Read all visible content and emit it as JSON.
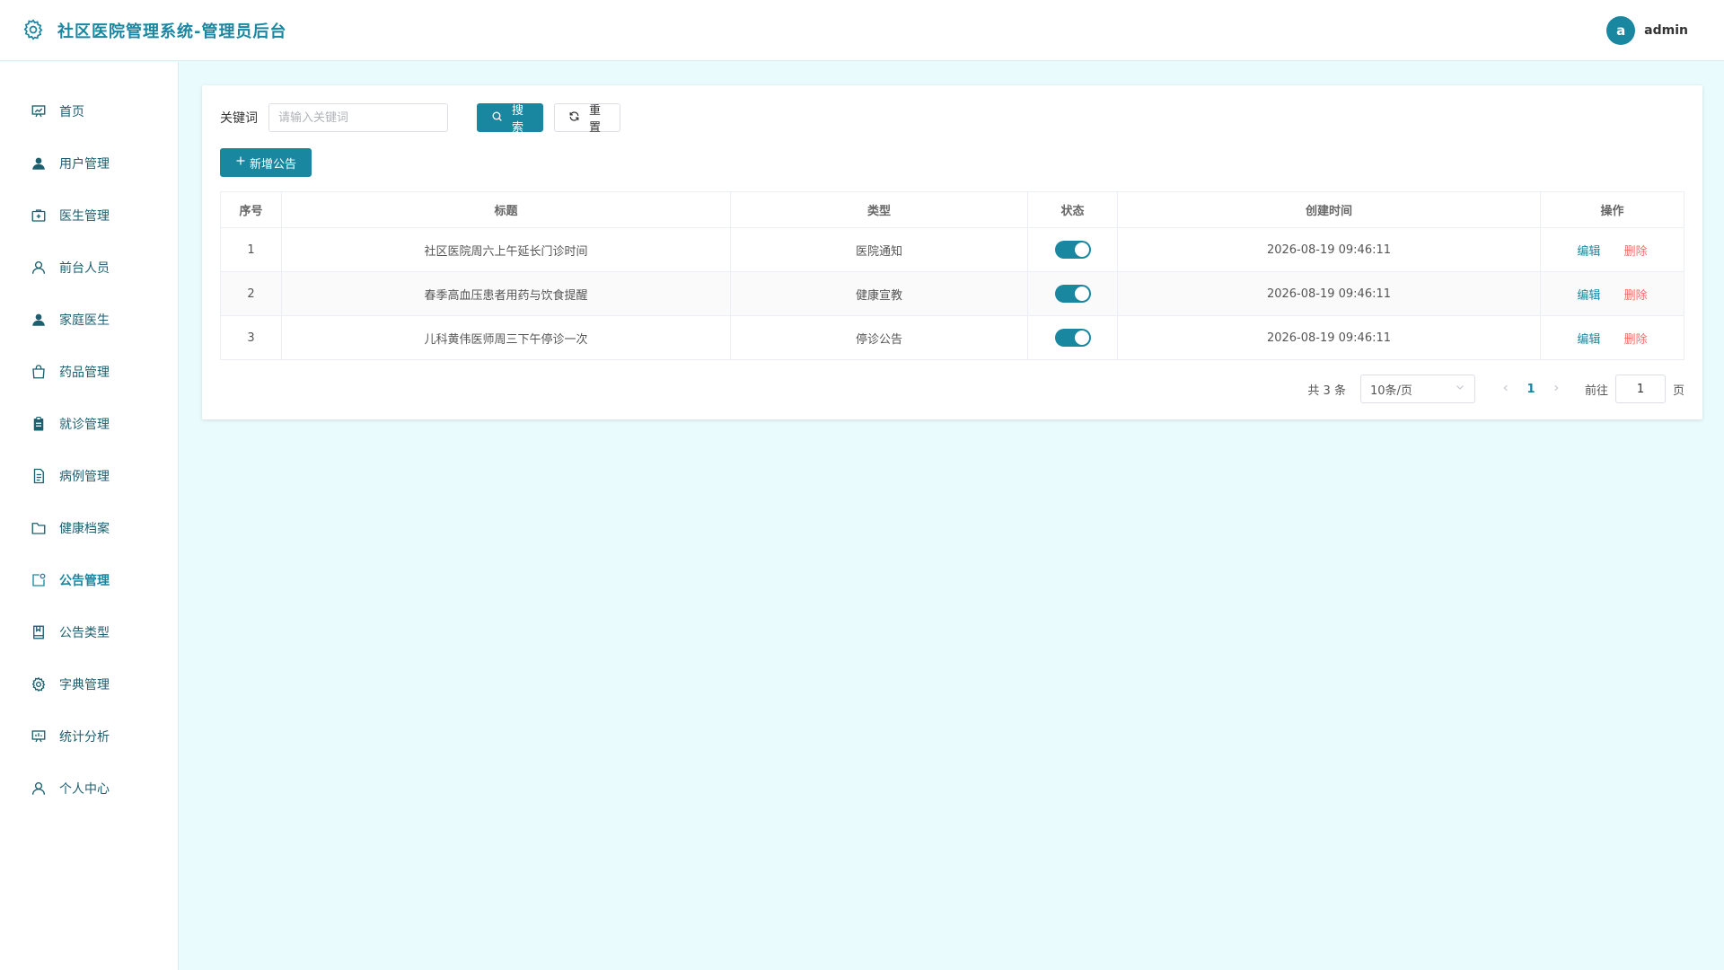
{
  "header": {
    "title": "社区医院管理系统-管理员后台",
    "avatar_letter": "a",
    "username": "admin"
  },
  "sidebar": {
    "active": "公告管理",
    "items": [
      {
        "label": "首页",
        "icon": "chart-board-icon"
      },
      {
        "label": "用户管理",
        "icon": "user-solid-icon"
      },
      {
        "label": "医生管理",
        "icon": "first-aid-kit-icon"
      },
      {
        "label": "前台人员",
        "icon": "user-outline-icon"
      },
      {
        "label": "家庭医生",
        "icon": "user-solid-icon"
      },
      {
        "label": "药品管理",
        "icon": "shopping-bag-icon"
      },
      {
        "label": "就诊管理",
        "icon": "clipboard-icon"
      },
      {
        "label": "病例管理",
        "icon": "document-icon"
      },
      {
        "label": "健康档案",
        "icon": "folder-icon"
      },
      {
        "label": "公告管理",
        "icon": "notification-icon"
      },
      {
        "label": "公告类型",
        "icon": "notebook-icon"
      },
      {
        "label": "字典管理",
        "icon": "gear-icon"
      },
      {
        "label": "统计分析",
        "icon": "chart-board-icon"
      },
      {
        "label": "个人中心",
        "icon": "user-outline-icon"
      }
    ]
  },
  "search": {
    "label": "关键词",
    "placeholder": "请输入关键词",
    "value": "",
    "search_button": "搜索",
    "reset_button": "重置"
  },
  "toolbar": {
    "add_button": "新增公告"
  },
  "table": {
    "headers": [
      "序号",
      "标题",
      "类型",
      "状态",
      "创建时间",
      "操作"
    ],
    "rows": [
      {
        "index": "1",
        "title": "社区医院周六上午延长门诊时间",
        "type": "医院通知",
        "status": true,
        "created": "2026-08-19 09:46:11"
      },
      {
        "index": "2",
        "title": "春季高血压患者用药与饮食提醒",
        "type": "健康宣教",
        "status": true,
        "created": "2026-08-19 09:46:11"
      },
      {
        "index": "3",
        "title": "儿科黄伟医师周三下午停诊一次",
        "type": "停诊公告",
        "status": true,
        "created": "2026-08-19 09:46:11"
      }
    ],
    "edit_label": "编辑",
    "delete_label": "删除"
  },
  "pagination": {
    "total": "共 3 条",
    "page_size": "10条/页",
    "current_page": "1",
    "goto_label": "前往",
    "goto_value": "1",
    "page_unit": "页"
  },
  "colors": {
    "primary": "#1a87a1",
    "danger": "#f56c6c",
    "background": "#eafbfd"
  }
}
